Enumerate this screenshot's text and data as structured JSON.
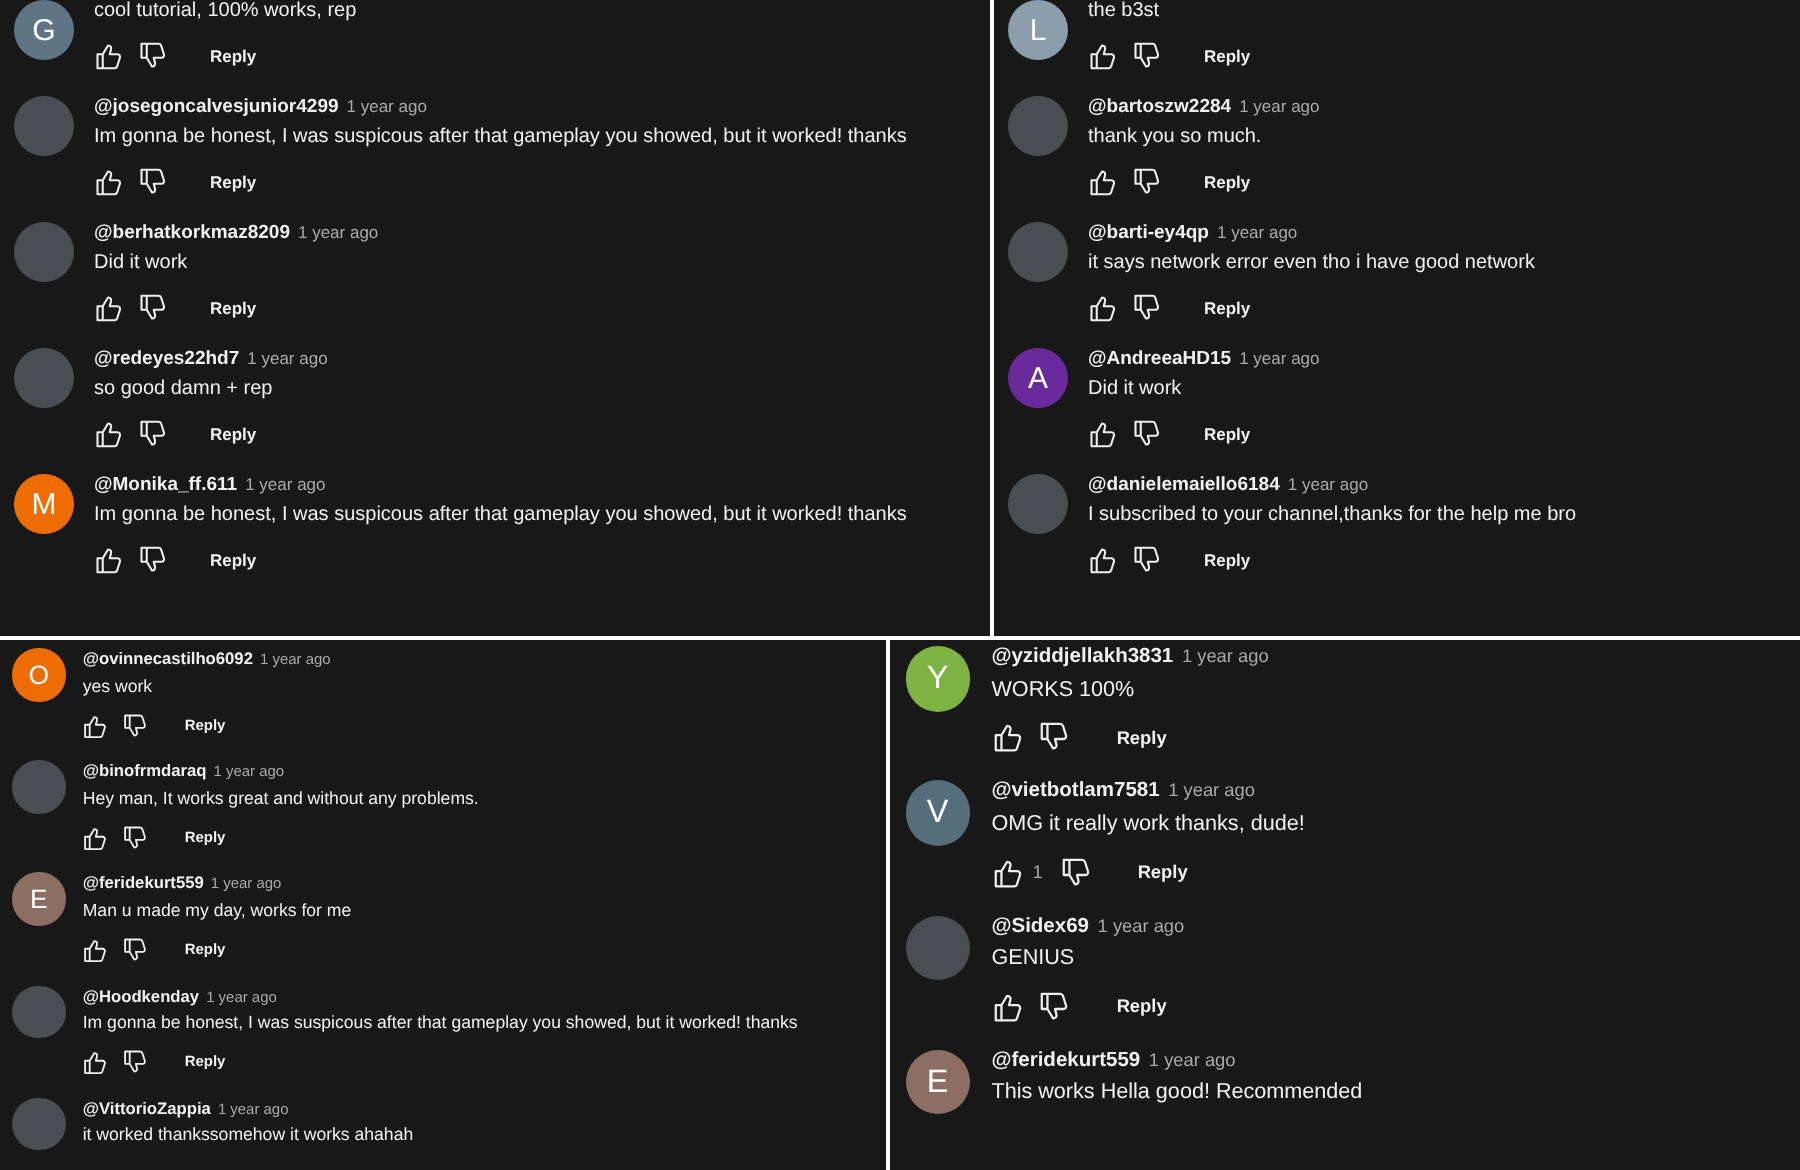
{
  "panels": [
    {
      "comments": [
        {
          "avatar": {
            "kind": "letter",
            "letter": "G",
            "color": "#5f7584"
          },
          "text": "cool tutorial, 100% works, rep",
          "reply": "Reply"
        },
        {
          "avatar": {
            "kind": "photo"
          },
          "handle": "@josegoncalvesjunior4299",
          "time": "1 year ago",
          "text": "Im gonna be honest, I was suspicous after that gameplay you showed, but it worked! thanks",
          "reply": "Reply"
        },
        {
          "avatar": {
            "kind": "photo"
          },
          "handle": "@berhatkorkmaz8209",
          "time": "1 year ago",
          "text": "Did it work",
          "reply": "Reply"
        },
        {
          "avatar": {
            "kind": "photo"
          },
          "handle": "@redeyes22hd7",
          "time": "1 year ago",
          "text": "so good damn + rep",
          "reply": "Reply"
        },
        {
          "avatar": {
            "kind": "letter",
            "letter": "M",
            "color": "#ef6c00"
          },
          "handle": "@Monika_ff.611",
          "time": "1 year ago",
          "text": "Im gonna be honest, I was suspicous after that gameplay you showed, but it worked! thanks",
          "reply": "Reply"
        }
      ]
    },
    {
      "comments": [
        {
          "avatar": {
            "kind": "letter",
            "letter": "L",
            "color": "#8a9eab"
          },
          "text": "the b3st",
          "reply": "Reply"
        },
        {
          "avatar": {
            "kind": "photo"
          },
          "handle": "@bartoszw2284",
          "time": "1 year ago",
          "text": "thank you so much.",
          "reply": "Reply"
        },
        {
          "avatar": {
            "kind": "photo"
          },
          "handle": "@barti-ey4qp",
          "time": "1 year ago",
          "text": "it says network error even tho i have good network",
          "reply": "Reply"
        },
        {
          "avatar": {
            "kind": "letter",
            "letter": "A",
            "color": "#6a2a9c"
          },
          "handle": "@AndreeaHD15",
          "time": "1 year ago",
          "text": "Did it work",
          "reply": "Reply"
        },
        {
          "avatar": {
            "kind": "photo"
          },
          "handle": "@danielemaiello6184",
          "time": "1 year ago",
          "text": "I subscribed to your channel,thanks for the help me bro",
          "reply": "Reply"
        }
      ]
    },
    {
      "comments": [
        {
          "avatar": {
            "kind": "letter",
            "letter": "O",
            "color": "#ef6c00"
          },
          "handle": "@ovinnecastilho6092",
          "time": "1 year ago",
          "text": "yes work",
          "reply": "Reply"
        },
        {
          "avatar": {
            "kind": "photo"
          },
          "handle": "@binofrmdaraq",
          "time": "1 year ago",
          "text": "Hey man, It works great and without any problems.",
          "reply": "Reply"
        },
        {
          "avatar": {
            "kind": "letter",
            "letter": "E",
            "color": "#8d6e63"
          },
          "handle": "@feridekurt559",
          "time": "1 year ago",
          "text": "Man u made my day, works for me",
          "reply": "Reply"
        },
        {
          "avatar": {
            "kind": "photo"
          },
          "handle": "@Hoodkenday",
          "time": "1 year ago",
          "text": "Im gonna be honest, I was suspicous after that gameplay you showed, but it worked! thanks",
          "reply": "Reply"
        },
        {
          "avatar": {
            "kind": "photo"
          },
          "handle": "@VittorioZappia",
          "time": "1 year ago",
          "text": "it worked thankssomehow it works ahahah"
        }
      ]
    },
    {
      "comments": [
        {
          "avatar": {
            "kind": "letter",
            "letter": "Y",
            "color": "#7cb342"
          },
          "handle": "@yziddjellakh3831",
          "time": "1 year ago",
          "text": "WORKS 100%",
          "reply": "Reply"
        },
        {
          "avatar": {
            "kind": "letter",
            "letter": "V",
            "color": "#546e7a"
          },
          "handle": "@vietbotlam7581",
          "time": "1 year ago",
          "text": "OMG it really work thanks, dude!",
          "likes": "1",
          "reply": "Reply"
        },
        {
          "avatar": {
            "kind": "photo"
          },
          "handle": "@Sidex69",
          "time": "1 year ago",
          "text": "GENIUS",
          "reply": "Reply"
        },
        {
          "avatar": {
            "kind": "letter",
            "letter": "E",
            "color": "#8d6e63"
          },
          "handle": "@feridekurt559",
          "time": "1 year ago",
          "text": "This works Hella good! Recommended"
        }
      ]
    }
  ]
}
